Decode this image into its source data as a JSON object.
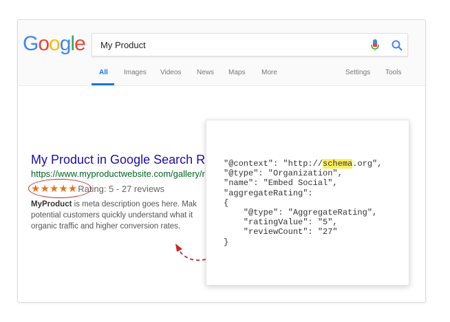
{
  "logo": {
    "letters": [
      "G",
      "o",
      "o",
      "g",
      "l",
      "e"
    ],
    "colors": [
      "#4285f4",
      "#ea4335",
      "#fbbc05",
      "#4285f4",
      "#34a853",
      "#ea4335"
    ]
  },
  "search": {
    "query": "My Product"
  },
  "tabs": [
    {
      "label": "All",
      "active": true
    },
    {
      "label": "Images"
    },
    {
      "label": "Videos"
    },
    {
      "label": "News"
    },
    {
      "label": "Maps"
    },
    {
      "label": "More"
    },
    {
      "label": "Settings"
    },
    {
      "label": "Tools"
    }
  ],
  "result": {
    "title": "My Product in Google Search Res",
    "url": "https://www.myproductwebsite.com/gallery/r",
    "stars": "★★★★★",
    "rating_text": "Rating: 5 - 27 reviews",
    "desc_bold": "MyProduct",
    "desc_line1": " is meta description goes here. Mak",
    "desc_line2": "potential customers quickly understand what it",
    "desc_line3": "organic traffic and higher conversion rates."
  },
  "code": {
    "line1_pre": "\"@context\": \"http://",
    "line1_hl": "schema",
    "line1_post": ".org\",",
    "line2": "\"@type\": \"Organization\",",
    "line3": "\"name\": \"Embed Social\",",
    "line4": "\"aggregateRating\":",
    "line5": "{",
    "line6": "    \"@type\": \"AggregateRating\",",
    "line7": "    \"ratingValue\": \"5\",",
    "line8": "    \"reviewCount\": \"27\"",
    "line9": "}"
  },
  "colors": {
    "accent": "#1a73e8",
    "title_link": "#1a0dab",
    "url_green": "#006621",
    "star_orange": "#e7711b",
    "annotation_red": "#c62828",
    "highlight": "#ffef5a"
  }
}
